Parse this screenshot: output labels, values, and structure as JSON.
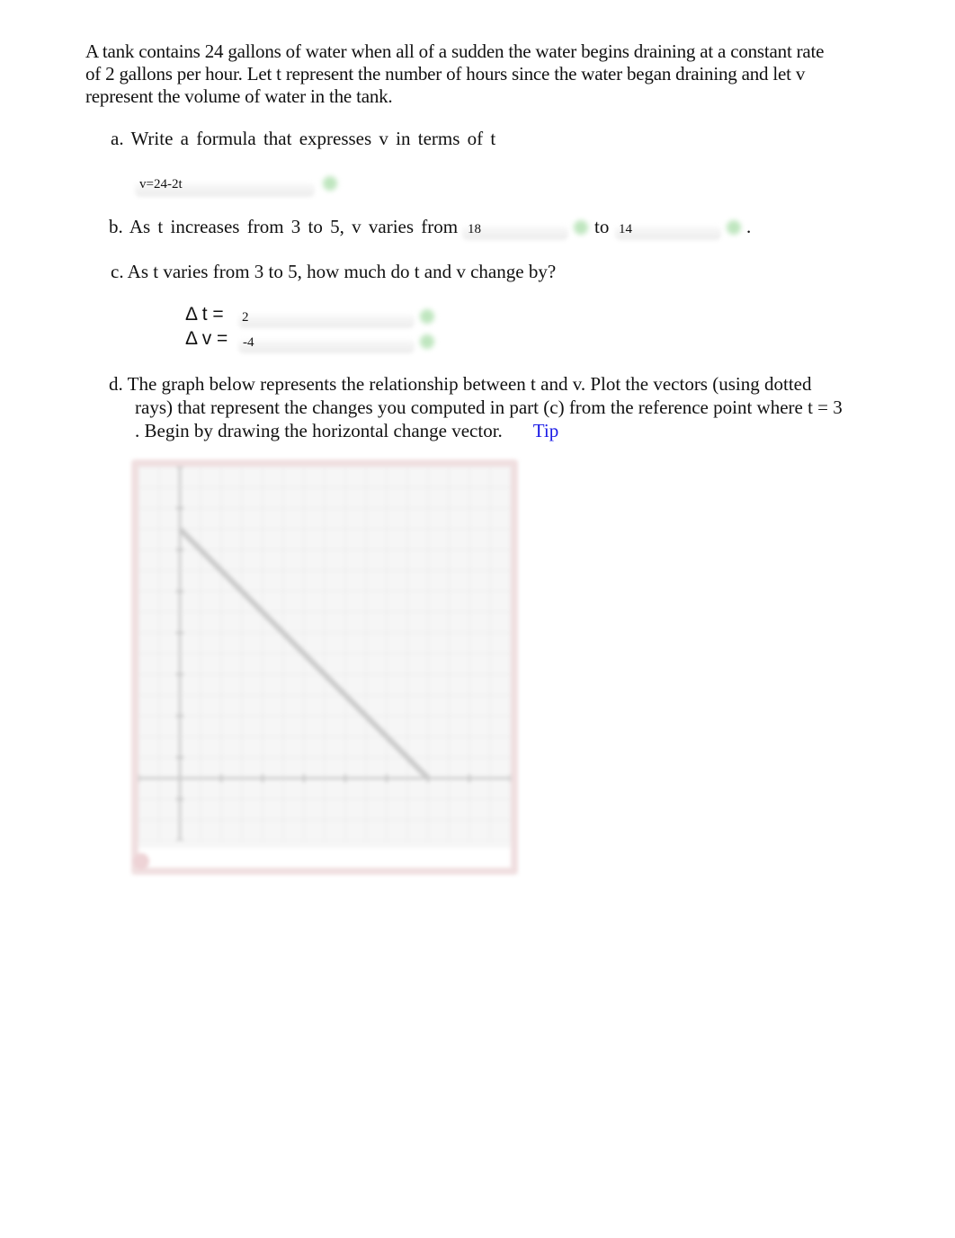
{
  "problem": {
    "intro_line1": "A tank contains 24 gallons of water when all of a sudden the water begins draining at a constant rate",
    "intro_line2": "of 2 gallons per hour. Let t represent the number of hours since the water began draining and let  v",
    "intro_line3": "represent the volume of water in the tank."
  },
  "part_a": {
    "prompt": "a. Write a formula that expresses v in terms of  t",
    "answer": "v=24-2t",
    "status": "correct"
  },
  "part_b": {
    "prompt_start": "b. As t increases from 3 to 5, v varies from",
    "answer_from": "18",
    "connector": "to",
    "answer_to": "14",
    "end": ".",
    "status": "correct"
  },
  "part_c": {
    "prompt": "c. As t varies from 3 to 5, how much do t and  v change by?",
    "delta_t_label": "Δ t =",
    "delta_t_value": "2",
    "delta_v_label": "Δ v =",
    "delta_v_value": "-4",
    "status": "correct"
  },
  "part_d": {
    "line1": "d. The graph below represents the relationship between t and  v. Plot the vectors (using dotted",
    "line2": "rays) that represent the changes you computed in part (c) from the reference point where t = 3",
    "line3": ". Begin by drawing the horizontal change vector.",
    "tip_label": "Tip"
  },
  "graph": {
    "state": "blurred",
    "border_color": "#f0dfe0",
    "line": {
      "from": [
        0,
        24
      ],
      "to": [
        12,
        0
      ]
    },
    "x_range": [
      -2,
      16
    ],
    "y_range": [
      -6,
      30
    ]
  }
}
